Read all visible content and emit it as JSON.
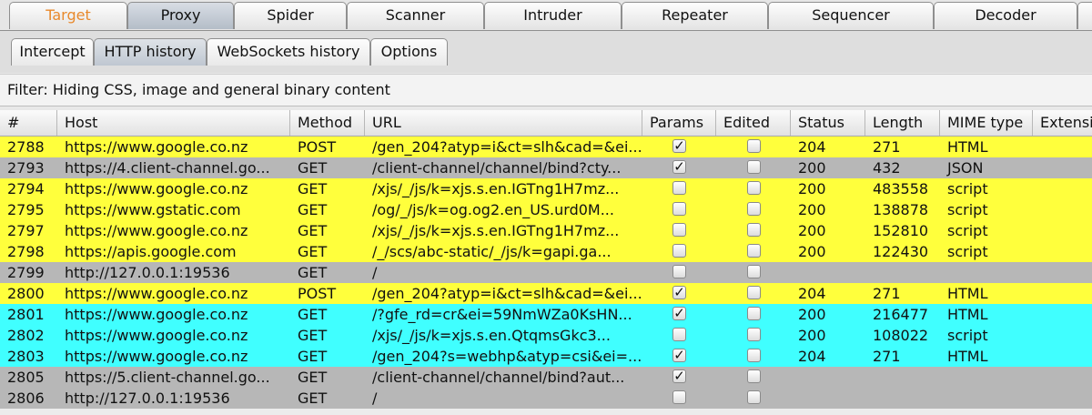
{
  "main_tabs": [
    "Target",
    "Proxy",
    "Spider",
    "Scanner",
    "Intruder",
    "Repeater",
    "Sequencer",
    "Decoder"
  ],
  "main_tab_active": "Proxy",
  "sub_tabs": [
    "Intercept",
    "HTTP history",
    "WebSockets history",
    "Options"
  ],
  "sub_tab_active": "HTTP history",
  "filter": {
    "text": "Filter: Hiding CSS, image and general binary content"
  },
  "table": {
    "columns": [
      "#",
      "Host",
      "Method",
      "URL",
      "Params",
      "Edited",
      "Status",
      "Length",
      "MIME type",
      "Extensi"
    ],
    "rows": [
      {
        "num": "2788",
        "host": "https://www.google.co.nz",
        "method": "POST",
        "url": "/gen_204?atyp=i&ct=slh&cad=&ei...",
        "params": true,
        "edited": false,
        "status": "204",
        "length": "271",
        "mime": "HTML",
        "color": "yellow"
      },
      {
        "num": "2793",
        "host": "https://4.client-channel.go...",
        "method": "GET",
        "url": "/client-channel/channel/bind?cty...",
        "params": true,
        "edited": false,
        "status": "200",
        "length": "432",
        "mime": "JSON",
        "color": "gray"
      },
      {
        "num": "2794",
        "host": "https://www.google.co.nz",
        "method": "GET",
        "url": "/xjs/_/js/k=xjs.s.en.IGTng1H7mz...",
        "params": false,
        "edited": false,
        "status": "200",
        "length": "483558",
        "mime": "script",
        "color": "yellow"
      },
      {
        "num": "2795",
        "host": "https://www.gstatic.com",
        "method": "GET",
        "url": "/og/_/js/k=og.og2.en_US.urd0M...",
        "params": false,
        "edited": false,
        "status": "200",
        "length": "138878",
        "mime": "script",
        "color": "yellow"
      },
      {
        "num": "2797",
        "host": "https://www.google.co.nz",
        "method": "GET",
        "url": "/xjs/_/js/k=xjs.s.en.IGTng1H7mz...",
        "params": false,
        "edited": false,
        "status": "200",
        "length": "152810",
        "mime": "script",
        "color": "yellow"
      },
      {
        "num": "2798",
        "host": "https://apis.google.com",
        "method": "GET",
        "url": "/_/scs/abc-static/_/js/k=gapi.ga...",
        "params": false,
        "edited": false,
        "status": "200",
        "length": "122430",
        "mime": "script",
        "color": "yellow"
      },
      {
        "num": "2799",
        "host": "http://127.0.0.1:19536",
        "method": "GET",
        "url": "/",
        "params": false,
        "edited": false,
        "status": "",
        "length": "",
        "mime": "",
        "color": "gray"
      },
      {
        "num": "2800",
        "host": "https://www.google.co.nz",
        "method": "POST",
        "url": "/gen_204?atyp=i&ct=slh&cad=&ei...",
        "params": true,
        "edited": false,
        "status": "204",
        "length": "271",
        "mime": "HTML",
        "color": "yellow"
      },
      {
        "num": "2801",
        "host": "https://www.google.co.nz",
        "method": "GET",
        "url": "/?gfe_rd=cr&ei=59NmWZa0KsHN...",
        "params": true,
        "edited": false,
        "status": "200",
        "length": "216477",
        "mime": "HTML",
        "color": "cyan"
      },
      {
        "num": "2802",
        "host": "https://www.google.co.nz",
        "method": "GET",
        "url": "/xjs/_/js/k=xjs.s.en.QtqmsGkc3...",
        "params": false,
        "edited": false,
        "status": "200",
        "length": "108022",
        "mime": "script",
        "color": "cyan"
      },
      {
        "num": "2803",
        "host": "https://www.google.co.nz",
        "method": "GET",
        "url": "/gen_204?s=webhp&atyp=csi&ei=...",
        "params": true,
        "edited": false,
        "status": "204",
        "length": "271",
        "mime": "HTML",
        "color": "cyan"
      },
      {
        "num": "2805",
        "host": "https://5.client-channel.go...",
        "method": "GET",
        "url": "/client-channel/channel/bind?aut...",
        "params": true,
        "edited": false,
        "status": "",
        "length": "",
        "mime": "",
        "color": "gray"
      },
      {
        "num": "2806",
        "host": "http://127.0.0.1:19536",
        "method": "GET",
        "url": "/",
        "params": false,
        "edited": false,
        "status": "",
        "length": "",
        "mime": "",
        "color": "gray"
      }
    ]
  },
  "colors": {
    "yellow": "#ffff3c",
    "gray": "#b7b7b7",
    "cyan": "#40ffff",
    "target_orange": "#e8892c"
  },
  "icons": {
    "checkmark": "checkmark-icon"
  }
}
